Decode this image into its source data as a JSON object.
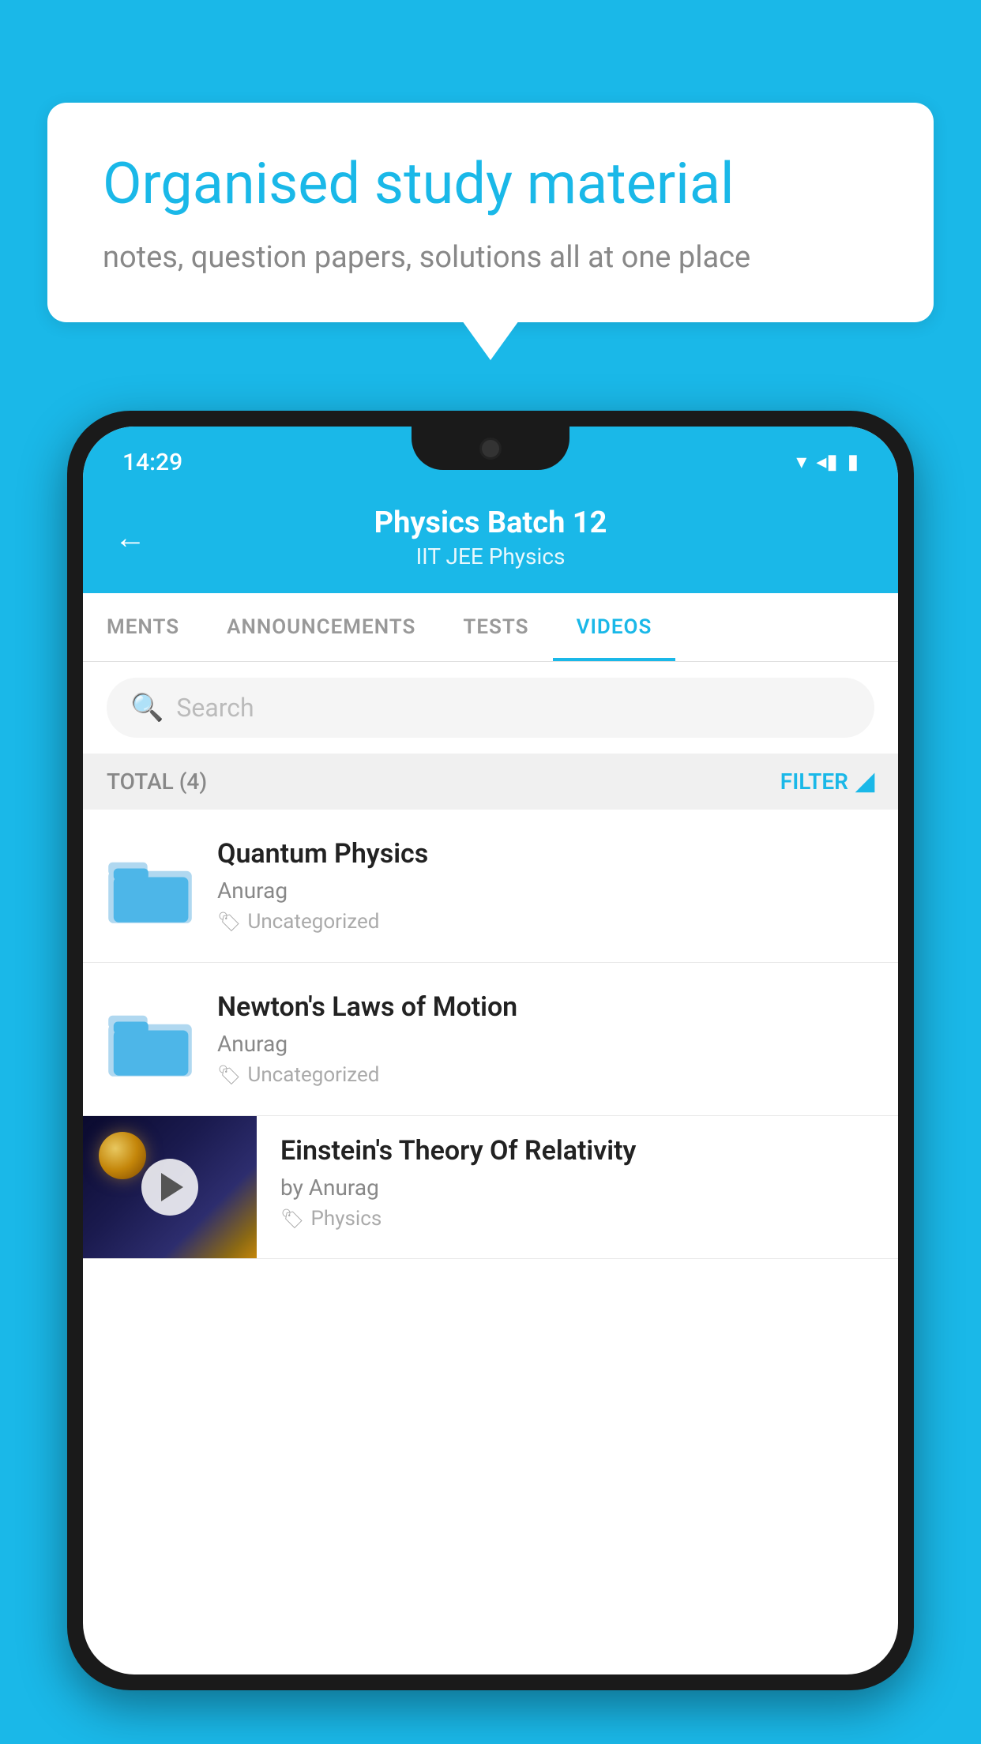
{
  "hero": {
    "bubble_title": "Organised study material",
    "bubble_subtitle": "notes, question papers, solutions all at one place"
  },
  "phone": {
    "status_time": "14:29",
    "header": {
      "batch_name": "Physics Batch 12",
      "tags": "IIT JEE   Physics",
      "back_label": "←"
    },
    "tabs": [
      {
        "label": "MENTS",
        "active": false
      },
      {
        "label": "ANNOUNCEMENTS",
        "active": false
      },
      {
        "label": "TESTS",
        "active": false
      },
      {
        "label": "VIDEOS",
        "active": true
      }
    ],
    "search": {
      "placeholder": "Search"
    },
    "filter_bar": {
      "total_label": "TOTAL (4)",
      "filter_label": "FILTER"
    },
    "videos": [
      {
        "title": "Quantum Physics",
        "author": "Anurag",
        "tag": "Uncategorized",
        "type": "folder"
      },
      {
        "title": "Newton's Laws of Motion",
        "author": "Anurag",
        "tag": "Uncategorized",
        "type": "folder"
      },
      {
        "title": "Einstein's Theory Of Relativity",
        "author": "by Anurag",
        "tag": "Physics",
        "type": "video"
      }
    ]
  }
}
